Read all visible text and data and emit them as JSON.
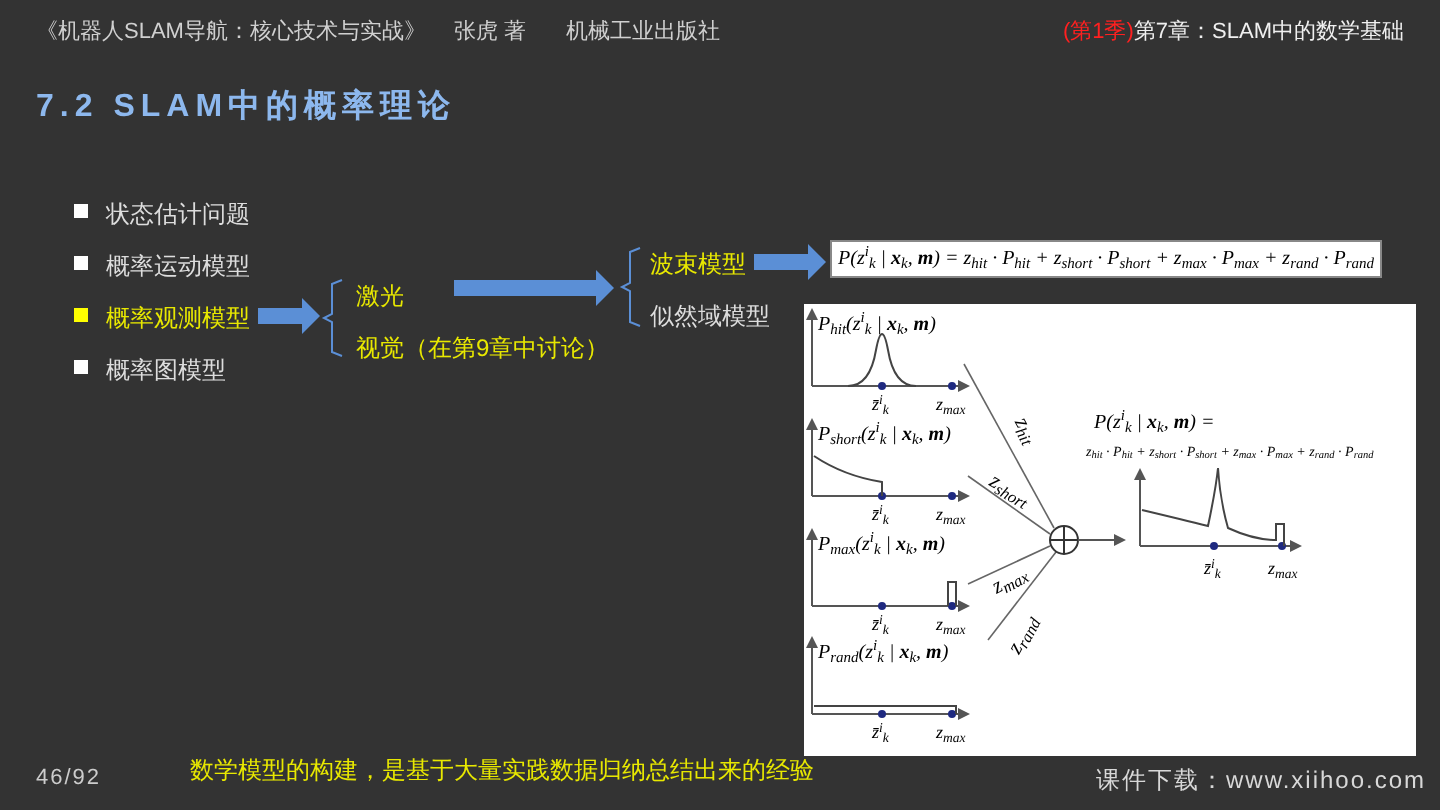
{
  "header": {
    "book_title": "《机器人SLAM导航：核心技术与实战》",
    "author": "张虎 著",
    "publisher": "机械工业出版社",
    "season": "(第1季)",
    "chapter": "第7章：SLAM中的数学基础"
  },
  "title": "7.2 SLAM中的概率理论",
  "bullets": [
    {
      "label": "状态估计问题",
      "selected": false
    },
    {
      "label": "概率运动模型",
      "selected": false
    },
    {
      "label": "概率观测模型",
      "selected": true
    },
    {
      "label": "概率图模型",
      "selected": false
    }
  ],
  "sensor_branches": [
    {
      "label": "激光",
      "selected": true
    },
    {
      "label": "视觉（在第9章中讨论）",
      "selected": true
    }
  ],
  "laser_models": [
    {
      "label": "波束模型",
      "selected": true
    },
    {
      "label": "似然域模型",
      "selected": false
    }
  ],
  "beam_formula": "P(z$^{i}$$_{k}$ | **x**$_{k}$, **m**) = z$_{hit}$ · P$_{hit}$ + z$_{short}$ · P$_{short}$ + z$_{max}$ · P$_{max}$ + z$_{rand}$ · P$_{rand}$",
  "figure": {
    "plots": [
      {
        "kind": "peak",
        "label": "P$_{hit}$(z$^{i}$$_{k}$ | **x**$_{k}$, **m**)",
        "x_labels": [
          "z̄$^{i}$$_{k}$",
          "z$_{max}$"
        ],
        "weight": "z$_{hit}$"
      },
      {
        "kind": "decay",
        "label": "P$_{short}$(z$^{i}$$_{k}$ | **x**$_{k}$, **m**)",
        "x_labels": [
          "z̄$^{i}$$_{k}$",
          "z$_{max}$"
        ],
        "weight": "z$_{short}$"
      },
      {
        "kind": "spike",
        "label": "P$_{max}$(z$^{i}$$_{k}$ | **x**$_{k}$, **m**)",
        "x_labels": [
          "z̄$^{i}$$_{k}$",
          "z$_{max}$"
        ],
        "weight": "z$_{max}$"
      },
      {
        "kind": "uniform",
        "label": "P$_{rand}$(z$^{i}$$_{k}$ | **x**$_{k}$, **m**)",
        "x_labels": [
          "z̄$^{i}$$_{k}$",
          "z$_{max}$"
        ],
        "weight": "z$_{rand}$"
      }
    ],
    "result_formula": [
      "P(z$^{i}$$_{k}$ | **x**$_{k}$, **m**) =",
      "z$_{hit}$ · P$_{hit}$ + z$_{short}$ · P$_{short}$ + z$_{max}$ · P$_{max}$ + z$_{rand}$ · P$_{rand}$"
    ],
    "result_x_labels": [
      "z̄$^{i}$$_{k}$",
      "z$_{max}$"
    ]
  },
  "footer": {
    "page": "46/92",
    "note": "数学模型的构建，是基于大量实践数据归纳总结出来的经验",
    "download": "课件下载：www.xiihoo.com"
  }
}
